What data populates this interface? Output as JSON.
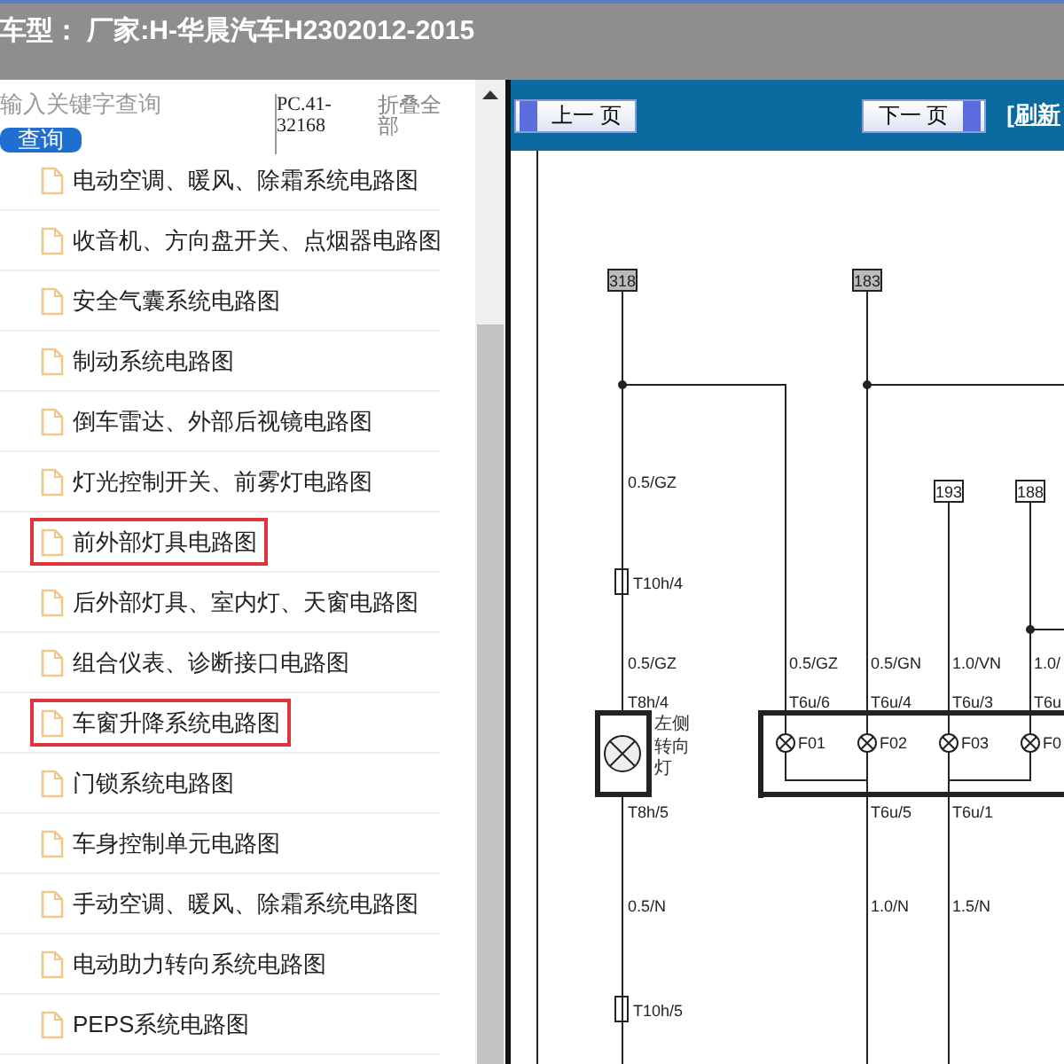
{
  "header": {
    "title": "车型：  厂家:H-华晨汽车H2302012-2015"
  },
  "sidebar": {
    "search": {
      "placeholder": "输入关键字查询"
    },
    "search_button": "查询",
    "code": "PC.41-32168",
    "collapse_all": "折叠全部",
    "items": [
      {
        "label": "电动空调、暖风、除霜系统电路图",
        "highlighted": false
      },
      {
        "label": "收音机、方向盘开关、点烟器电路图",
        "highlighted": false
      },
      {
        "label": "安全气囊系统电路图",
        "highlighted": false
      },
      {
        "label": "制动系统电路图",
        "highlighted": false
      },
      {
        "label": "倒车雷达、外部后视镜电路图",
        "highlighted": false
      },
      {
        "label": "灯光控制开关、前雾灯电路图",
        "highlighted": false
      },
      {
        "label": "前外部灯具电路图",
        "highlighted": true
      },
      {
        "label": "后外部灯具、室内灯、天窗电路图",
        "highlighted": false
      },
      {
        "label": "组合仪表、诊断接口电路图",
        "highlighted": false
      },
      {
        "label": "车窗升降系统电路图",
        "highlighted": true
      },
      {
        "label": "门锁系统电路图",
        "highlighted": false
      },
      {
        "label": "车身控制单元电路图",
        "highlighted": false
      },
      {
        "label": "手动空调、暖风、除霜系统电路图",
        "highlighted": false
      },
      {
        "label": "电动助力转向系统电路图",
        "highlighted": false
      },
      {
        "label": "PEPS系统电路图",
        "highlighted": false
      }
    ]
  },
  "viewer": {
    "prev_button": "上一 页",
    "next_button": "下一 页",
    "refresh_link": "[刷新",
    "diagram": {
      "terminals": [
        "318",
        "183",
        "193",
        "188"
      ],
      "left_circuit": {
        "wire_top": "0.5/GZ",
        "connector_top": "T10h/4",
        "wire_mid": "0.5/GZ",
        "pin_in": "T8h/4",
        "lamp_label": "左侧转向灯",
        "pin_out": "T8h/5",
        "wire_ground": "0.5/N",
        "connector_bottom": "T10h/5"
      },
      "fuse_box": [
        {
          "wire": "0.5/GZ",
          "pin": "T6u/6",
          "fuse": "F01"
        },
        {
          "wire": "0.5/GN",
          "pin": "T6u/4",
          "fuse": "F02",
          "pin_out": "T6u/5",
          "wire_out": "1.0/N"
        },
        {
          "wire": "1.0/VN",
          "pin": "T6u/3",
          "fuse": "F03",
          "pin_out": "T6u/1",
          "wire_out": "1.5/N"
        },
        {
          "wire": "1.0/",
          "pin": "T6u",
          "fuse": "F0"
        }
      ]
    }
  }
}
